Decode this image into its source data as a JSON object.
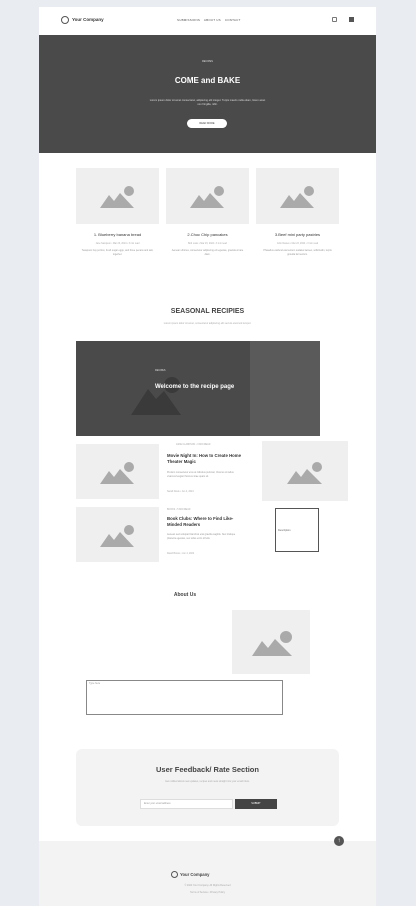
{
  "header": {
    "brand": "Your Company",
    "nav": [
      "SUBMISSIONS",
      "ABOUT US",
      "CONTACT"
    ]
  },
  "hero": {
    "tag": "RECIPES",
    "title": "COME and BAKE",
    "subtitle": "Lorem ipsum dolor sit amet consectetur, adipiscing elit integer. Turpis mauris nulla etiam, lorem amet non fringilla, nibh.",
    "button": "READ MORE"
  },
  "cards": [
    {
      "title": "1. Blueberry banana bread",
      "meta": "Jane Sampson • Mar 23, 2024 • 3 min read",
      "desc": "Teaspoon hay portion, fresh sugar eggs, and three pecans and salt, together."
    },
    {
      "title": "2.Choc Chip pancakes",
      "meta": "Bob Louis • Mar 23, 2024 • 3 min read",
      "desc": "Aenean ultricies, consectetur adipiscing elit egestas, gravida ornare diam."
    },
    {
      "title": "3.Beef mini party pastries",
      "meta": "John Davies • Mar 23, 2024 • 3 min read",
      "desc": "Phasellus eleifend elementum sodales laoreet, sollicitudin, turpis gravida fermentum."
    }
  ],
  "seasonal": {
    "title": "SEASONAL RECIPIES",
    "subtitle": "Lorem ipsum dolor sit amet, consectetur adipiscing elit sed do eiusmod tempor."
  },
  "banner": {
    "tag": "RECIPES",
    "title": "Welcome to the recipe page"
  },
  "posts": [
    {
      "meta": "JANE CLARKSON • 3 MIN READ",
      "title": "Movie Night In: How to Create Home Theater Magic",
      "desc": "Pretium consectetur eros at ridiculus pulvinar, rhoncus sit tellus vivamus feugiat rhoncus vitae quam sit.",
      "author": "Sarah Davis • Jun 4, 2024"
    },
    {
      "meta": "BOOKS • 5 MIN READ",
      "title": "Book Clubs: Where to Find Like-Minded Readers",
      "desc": "Aenean sed volutpat blandit at erat gravida sagittis. Nec tristique pharetra egestas, nec tellus enim id felis.",
      "author": "David Brown • Jun 4, 2024"
    }
  ],
  "description_label": "Description",
  "about": {
    "title": "About Us",
    "textarea_label": "Type here"
  },
  "feedback": {
    "title": "User Feedback/ Rate Section",
    "subtitle": "Get notified about new updates, recipes and news straight into your email inbox.",
    "input_placeholder": "Enter your email address",
    "button": "SUBMIT"
  },
  "scroll_top": "↑",
  "footer": {
    "brand": "Your Company",
    "copyright": "© 2024 Your Company. All Rights Reserved",
    "links": "Terms of Service  •  Privacy Policy"
  }
}
